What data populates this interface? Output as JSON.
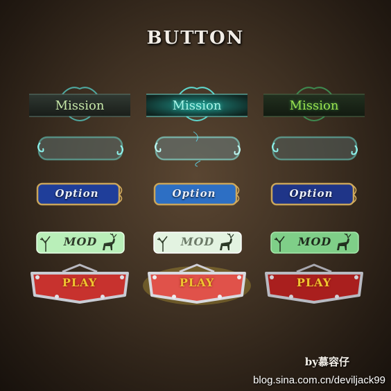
{
  "title": "BUTTON",
  "rows": {
    "mission": {
      "label": "Mission",
      "states": [
        {
          "text_color": "#c6e7a8",
          "glow": "#2a8a80"
        },
        {
          "text_color": "#a8f3e6",
          "glow": "#38d9c8"
        },
        {
          "text_color": "#9be04e",
          "glow": "#3aa048"
        }
      ]
    },
    "frame": {
      "states": [
        {
          "stroke": "#6fe0d6"
        },
        {
          "stroke": "#8ff5ee"
        },
        {
          "stroke": "#6fe0d6"
        }
      ]
    },
    "option": {
      "label": "Option",
      "states": [
        {
          "fill": "#1f3e9a"
        },
        {
          "fill": "#2d6fc4"
        },
        {
          "fill": "#1f3588"
        }
      ]
    },
    "mod": {
      "label": "MOD",
      "states": [
        {
          "fill": "#b9efb9"
        },
        {
          "fill": "#e3f3e1"
        },
        {
          "fill": "#7fcf88"
        }
      ]
    },
    "play": {
      "label": "PLAY",
      "states": [
        {
          "fill": "#c7322e"
        },
        {
          "fill": "#e0524a"
        },
        {
          "fill": "#a91f1e"
        }
      ]
    }
  },
  "credit": "by慕容仔",
  "watermark": "blog.sina.com.cn/deviljack99"
}
